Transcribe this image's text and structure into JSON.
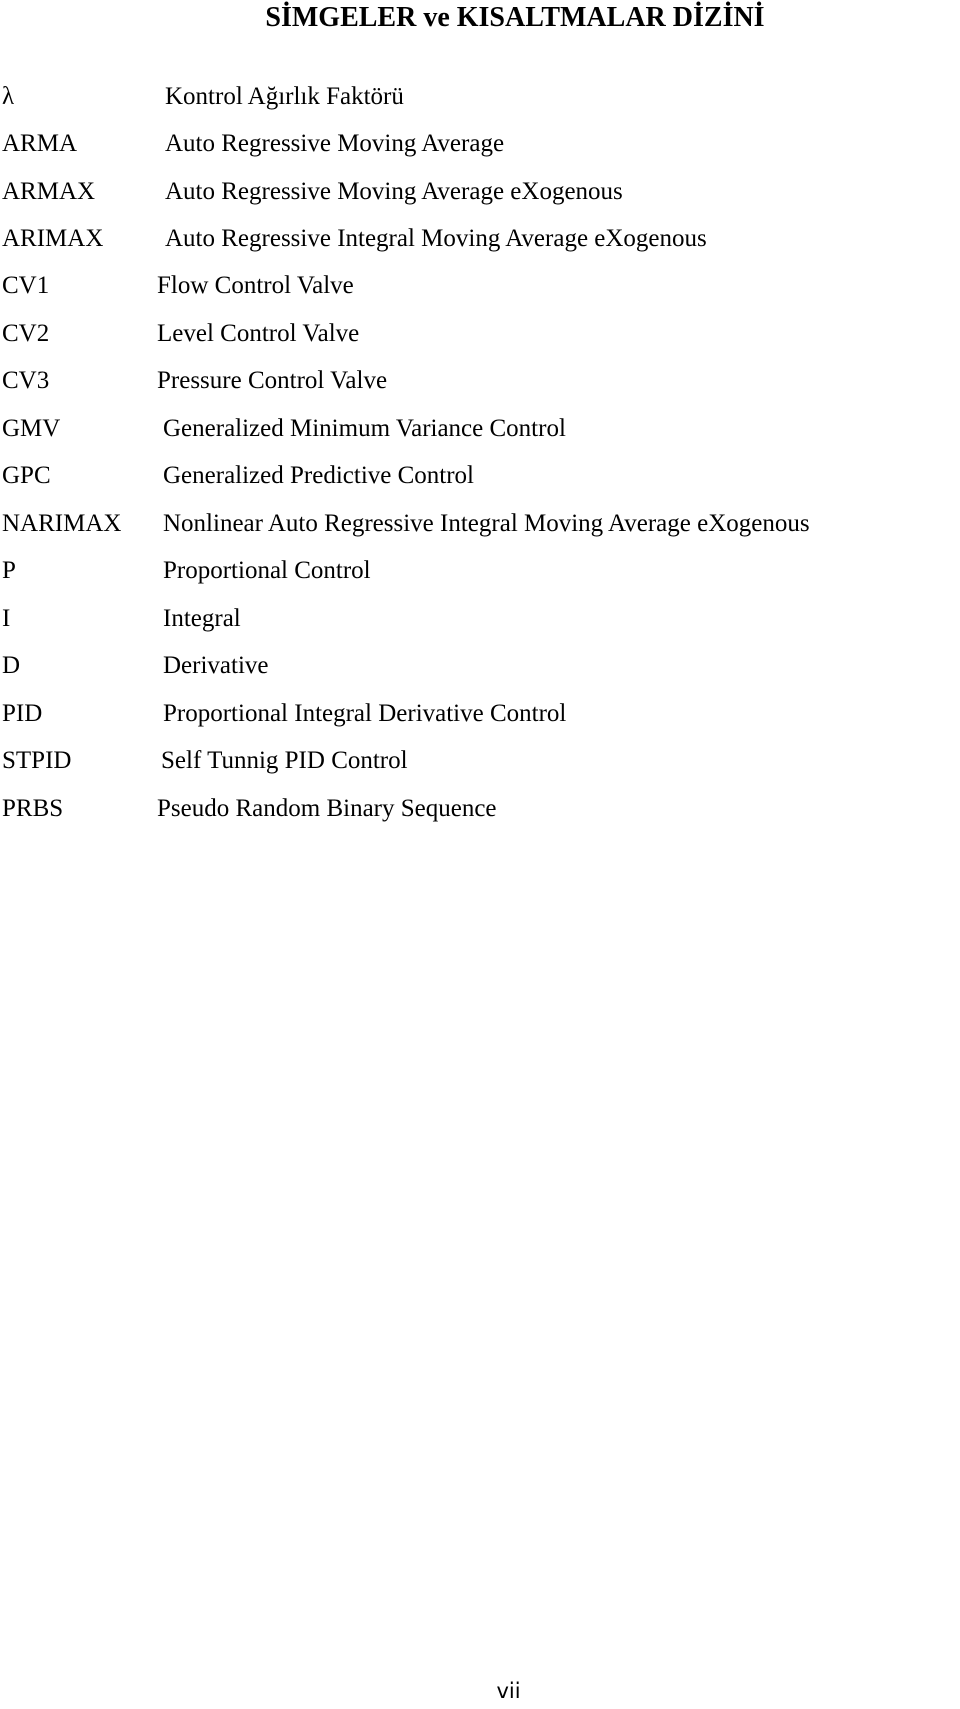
{
  "page": {
    "title": "SİMGELER ve KISALTMALAR DİZİNİ",
    "page_number": "vii"
  },
  "entries": [
    {
      "abbr": "λ",
      "definition": "Kontrol Ağırlık Faktörü"
    },
    {
      "abbr": "ARMA",
      "definition": "Auto Regressive Moving Average"
    },
    {
      "abbr": "ARMAX",
      "definition": "Auto Regressive Moving Average eXogenous"
    },
    {
      "abbr": "ARIMAX",
      "definition": "Auto Regressive Integral Moving Average eXogenous"
    },
    {
      "abbr": "CV1",
      "definition": "Flow Control Valve"
    },
    {
      "abbr": "CV2",
      "definition": "Level Control Valve"
    },
    {
      "abbr": "CV3",
      "definition": "Pressure Control Valve"
    },
    {
      "abbr": "GMV",
      "definition": "Generalized Minimum Variance Control"
    },
    {
      "abbr": "GPC",
      "definition": "Generalized Predictive Control"
    },
    {
      "abbr": "NARIMAX",
      "definition": "Nonlinear Auto Regressive Integral Moving Average eXogenous"
    },
    {
      "abbr": "P",
      "definition": "Proportional Control"
    },
    {
      "abbr": "I",
      "definition": "Integral"
    },
    {
      "abbr": "D",
      "definition": "Derivative"
    },
    {
      "abbr": "PID",
      "definition": "Proportional Integral Derivative Control"
    },
    {
      "abbr": "STPID",
      "definition": "Self Tunnig PID Control"
    },
    {
      "abbr": "PRBS",
      "definition": "Pseudo Random Binary Sequence"
    }
  ]
}
